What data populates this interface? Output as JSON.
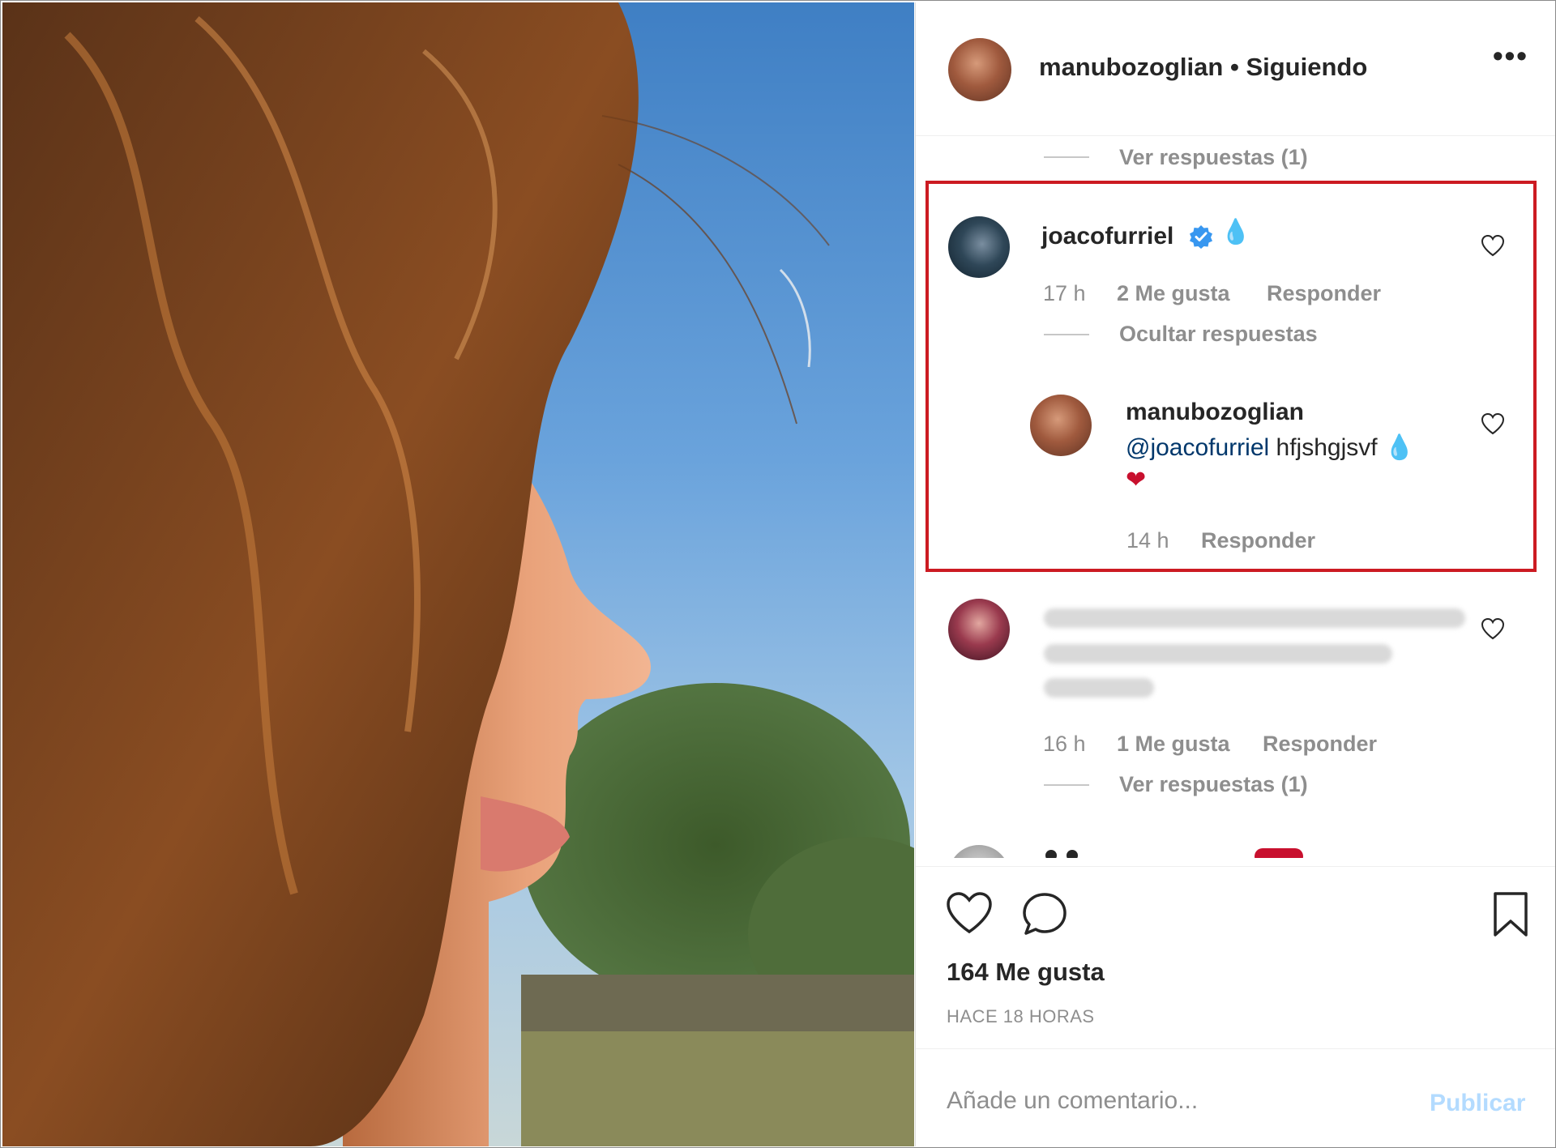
{
  "post": {
    "owner": "manubozoglian",
    "separator": "•",
    "follow_status": "Siguiendo",
    "more_label": "•••"
  },
  "comments": {
    "top_view_replies": "Ver respuestas (1)",
    "c1": {
      "username": "joacofurriel",
      "emoji": "💧",
      "time": "17 h",
      "likes": "2 Me gusta",
      "reply": "Responder",
      "hide_replies": "Ocultar respuestas",
      "reply1": {
        "username": "manubozoglian",
        "mention": "@joacofurriel",
        "text": "hfjshgjsvf",
        "emoji_drop": "💧",
        "emoji_heart": "❤",
        "time": "14 h",
        "reply": "Responder"
      }
    },
    "c2": {
      "time": "16 h",
      "likes": "1 Me gusta",
      "reply": "Responder",
      "view_replies": "Ver respuestas (1)"
    }
  },
  "footer": {
    "likes": "164 Me gusta",
    "ago": "HACE 18 HORAS",
    "comment_placeholder": "Añade un comentario...",
    "publish": "Publicar"
  },
  "icons": {
    "like": "heart-icon",
    "comment": "comment-bubble-icon",
    "save": "bookmark-icon",
    "verified": "verified-badge-icon"
  },
  "colors": {
    "highlight": "#cc1b22",
    "mention": "#00376b",
    "verified": "#3897f0",
    "publish_disabled": "#b3dbff"
  }
}
